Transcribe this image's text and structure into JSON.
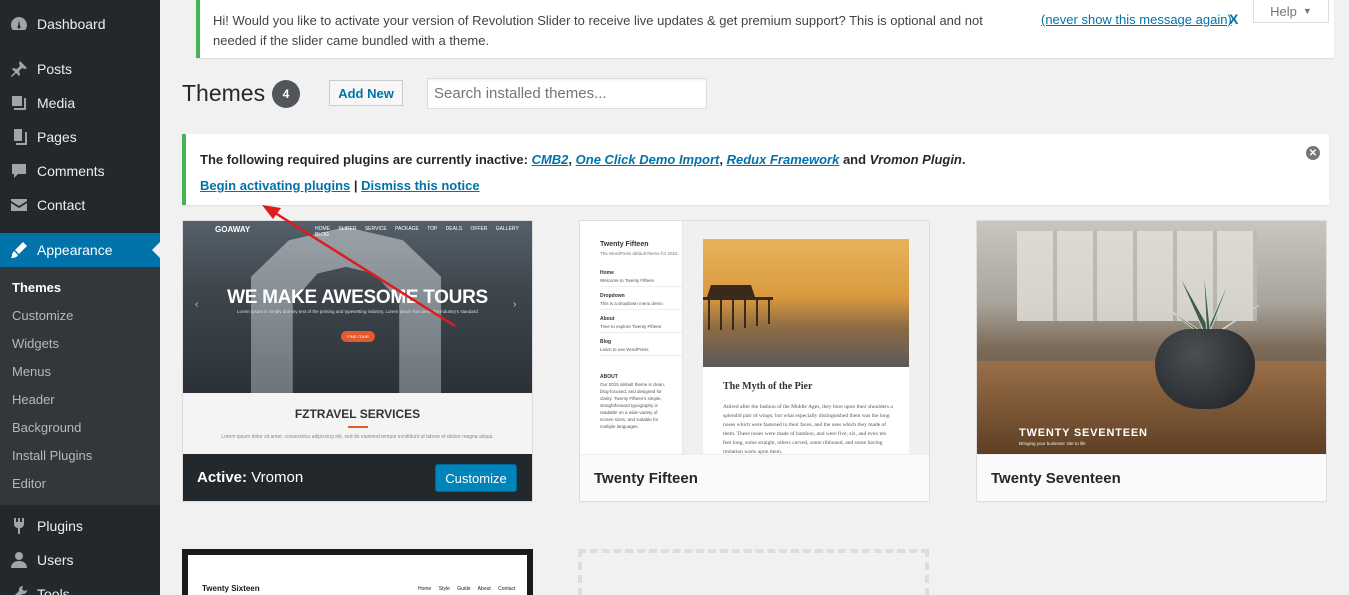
{
  "sidebar": {
    "items": [
      {
        "label": "Dashboard",
        "icon": "dashboard-icon"
      },
      {
        "label": "Posts",
        "icon": "pin-icon"
      },
      {
        "label": "Media",
        "icon": "media-icon"
      },
      {
        "label": "Pages",
        "icon": "pages-icon"
      },
      {
        "label": "Comments",
        "icon": "comment-icon"
      },
      {
        "label": "Contact",
        "icon": "envelope-icon"
      },
      {
        "label": "Appearance",
        "icon": "paintbrush-icon"
      }
    ],
    "submenu": [
      "Themes",
      "Customize",
      "Widgets",
      "Menus",
      "Header",
      "Background",
      "Install Plugins",
      "Editor"
    ],
    "items_after": [
      {
        "label": "Plugins",
        "icon": "plug-icon"
      },
      {
        "label": "Users",
        "icon": "user-icon"
      },
      {
        "label": "Tools",
        "icon": "wrench-icon"
      }
    ],
    "accent": "#0073aa"
  },
  "revslider_notice": {
    "message": "Hi! Would you like to activate your version of Revolution Slider to receive live updates & get premium support? This is optional and not needed if the slider came bundled with a theme.",
    "never_show": "(never show this message again)",
    "close": "X"
  },
  "help": {
    "label": "Help"
  },
  "header": {
    "title": "Themes",
    "count": "4",
    "add_new": "Add New",
    "search_placeholder": "Search installed themes..."
  },
  "plugins_notice": {
    "lead": "The following required plugins are currently inactive: ",
    "plugins": [
      "CMB2",
      "One Click Demo Import",
      "Redux Framework"
    ],
    "sep": ", ",
    "and": " and ",
    "last": "Vromon Plugin",
    "end": ".",
    "begin": "Begin activating plugins",
    "pipe": " | ",
    "dismiss": "Dismiss this notice"
  },
  "themes": {
    "vromon": {
      "active_prefix": "Active:",
      "name": "Vromon",
      "customize": "Customize",
      "shot": {
        "logo": "GOAWAY",
        "nav": "HOME SLIDER SERVICE PACKAGE TOP DEALS OFFER GALLERY BLOG",
        "headline": "WE MAKE AWESOME TOURS",
        "sub": "Lorem ipsum is simply dummy text of the printing and typesetting industry. Lorem Ipsum has been the industry's standard",
        "button": "FIND TOUR",
        "services": "FZTRAVEL SERVICES",
        "lorem": "Lorem ipsum dolor sit amet, consectetur adipiscing elit, sed do eiusmod tempor incididunt ut labore et dolore magna aliqua."
      }
    },
    "twentyfifteen": {
      "name": "Twenty Fifteen",
      "shot": {
        "site_title": "Twenty Fifteen",
        "site_desc": "The WordPress default theme for 2015.",
        "widgets": [
          "Home",
          "Welcome to Twenty Fifteen",
          "Dropdown",
          "This is a dropdown menu demo",
          "About",
          "Time to explore Twenty Fifteen",
          "Blog",
          "Learn to use WordPress"
        ],
        "about_head": "ABOUT",
        "about_text": "Our 2015 default theme is clean, blog-focused, and designed for clarity. Twenty Fifteen's simple, straightforward typography is readable on a wide variety of screen sizes, and suitable for multiple languages.",
        "post_title": "The Myth of the Pier",
        "post_body": "Attired after the fashion of the Middle Ages, they bore upon their shoulders a splendid pair of wings; but what especially distinguished them was the long noses which were fastened to their faces, and the uses which they made of them. These noses were made of bamboo, and were five, six, and even ten feet long, some straight, others curved, some ribboned, and some having imitation warts upon them."
      }
    },
    "twentyseventeen": {
      "name": "Twenty Seventeen",
      "shot": {
        "title": "TWENTY SEVENTEEN",
        "sub": "Bringing your business' site to life"
      }
    },
    "twentysixteen": {
      "shot": {
        "title": "Twenty Sixteen",
        "nav": "Home Style Guide About Contact"
      }
    }
  }
}
